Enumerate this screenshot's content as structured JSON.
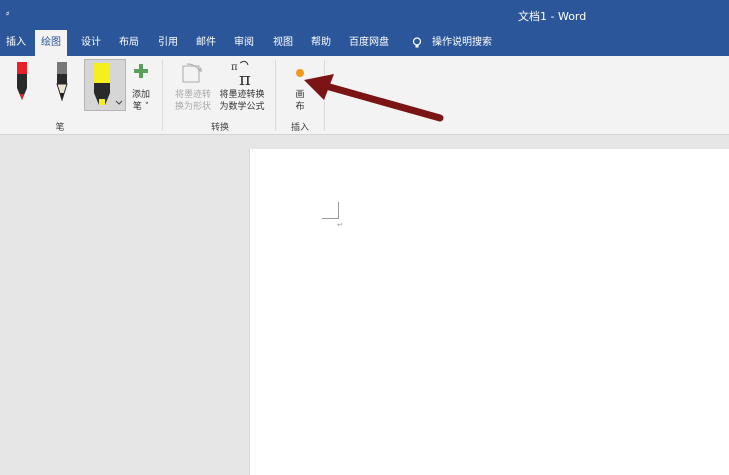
{
  "window": {
    "quick_access": "⸗",
    "title": "文档1 - Word"
  },
  "tabs": [
    {
      "label": "插入"
    },
    {
      "label": "绘图",
      "active": true
    },
    {
      "label": "设计"
    },
    {
      "label": "布局"
    },
    {
      "label": "引用"
    },
    {
      "label": "邮件"
    },
    {
      "label": "审阅"
    },
    {
      "label": "视图"
    },
    {
      "label": "帮助"
    },
    {
      "label": "百度网盘"
    }
  ],
  "tell_me": {
    "icon": "lightbulb-icon",
    "label": "操作说明搜索"
  },
  "ribbon": {
    "pens_group": {
      "label": "笔",
      "pens": [
        {
          "icon": "red-pen-icon",
          "color": "#e8202a"
        },
        {
          "icon": "black-pencil-icon",
          "color": "#222222"
        },
        {
          "icon": "yellow-highlighter-icon",
          "color": "#f7ef1d",
          "selected": true
        }
      ],
      "add_pen_label_line1": "添加",
      "add_pen_label_line2": "笔 ˅",
      "add_pen_icon": "plus-icon",
      "add_pen_color": "#5aa05a"
    },
    "convert_group": {
      "label": "转换",
      "ink_to_shape_line1": "将墨迹转",
      "ink_to_shape_line2": "换为形状",
      "ink_to_shape_icon": "ink-to-shape-icon",
      "ink_to_math_line1": "将墨迹转换",
      "ink_to_math_line2": "为数学公式",
      "ink_to_math_icon": "pi-icon"
    },
    "insert_group": {
      "label": "插入",
      "canvas_line1": "画",
      "canvas_line2": "布",
      "canvas_icon": "orange-dot-icon",
      "canvas_color": "#f39a1e"
    }
  },
  "annotation": {
    "arrow_icon": "dark-red-arrow-icon",
    "color": "#7b1414"
  },
  "document": {
    "paragraph_mark": "↵"
  }
}
